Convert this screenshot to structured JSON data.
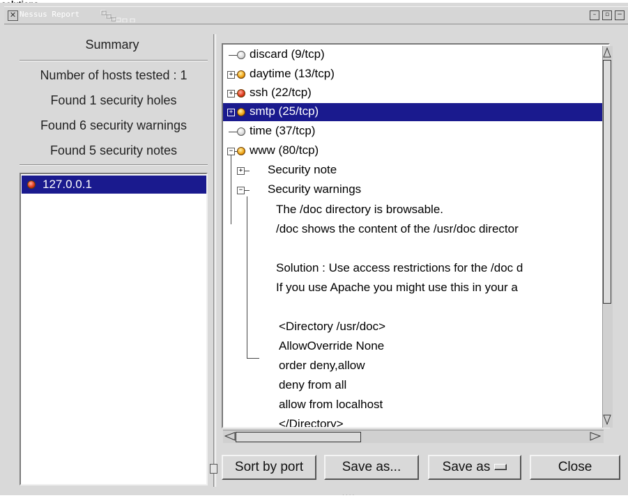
{
  "top_crop_text": "solutions",
  "window": {
    "title": "Nessus Report",
    "colors": {
      "selection": "#1a1a8e",
      "background": "#d9d9d9"
    }
  },
  "summary": {
    "heading": "Summary",
    "hosts_tested": "Number of hosts tested : 1",
    "holes": "Found 1 security holes",
    "warnings": "Found 6 security warnings",
    "notes": "Found 5 security notes"
  },
  "hosts": [
    {
      "label": "127.0.0.1",
      "status_icon": "red-dot-icon",
      "selected": true
    }
  ],
  "tree": {
    "ports": [
      {
        "label": "discard (9/tcp)",
        "status": "white"
      },
      {
        "label": "daytime (13/tcp)",
        "status": "yellow"
      },
      {
        "label": "ssh (22/tcp)",
        "status": "red"
      },
      {
        "label": "smtp (25/tcp)",
        "status": "yellow",
        "selected": true
      },
      {
        "label": "time (37/tcp)",
        "status": "white"
      },
      {
        "label": "www (80/tcp)",
        "status": "yellow"
      }
    ],
    "children": {
      "security_note": "Security note",
      "security_warnings": "Security warnings"
    },
    "warning_text": [
      "The /doc directory is browsable.",
      "/doc shows the content of the /usr/doc director",
      "",
      "Solution : Use access restrictions for the /doc d",
      "If you use Apache you might use this in your a",
      "",
      "<Directory /usr/doc>",
      "AllowOverride None",
      "order deny,allow",
      "deny from all",
      "allow from localhost",
      "</Directory>"
    ]
  },
  "buttons": {
    "sort_by_port": "Sort by port",
    "save_as": "Save as...",
    "save_as_option": "Save as",
    "close": "Close"
  }
}
